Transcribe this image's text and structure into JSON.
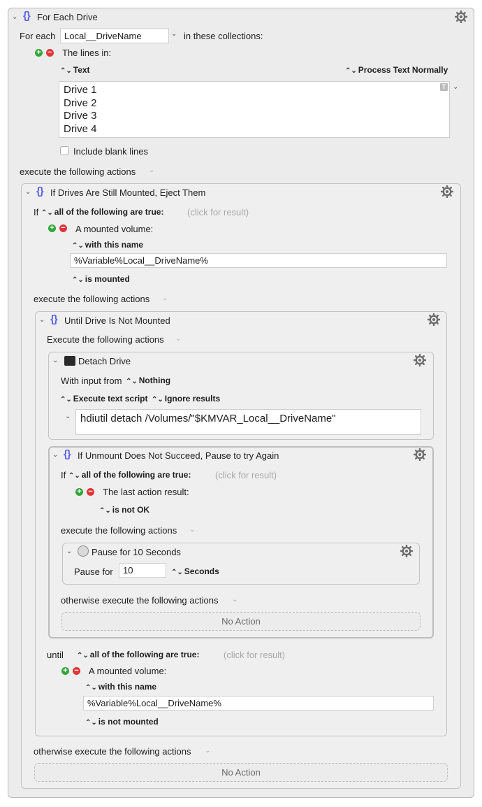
{
  "for_each": {
    "title": "For Each Drive",
    "for_each_label": "For each",
    "variable": "Local__DriveName",
    "in_collections": "in these collections:",
    "collection_title": "The lines in:",
    "text_label": "Text",
    "process_label": "Process Text Normally",
    "lines": [
      "Drive 1",
      "Drive 2",
      "Drive 3",
      "Drive 4"
    ],
    "include_blank": "Include blank lines",
    "execute_label": "execute the following actions"
  },
  "if_mounted": {
    "title": "If Drives Are Still Mounted, Eject Them",
    "if_label": "If",
    "condition_mode": "all of the following are true:",
    "click_result": "(click for result)",
    "condition_title": "A mounted volume:",
    "with_name": "with this name",
    "name_value": "%Variable%Local__DriveName%",
    "state": "is mounted",
    "execute_label": "execute the following actions",
    "otherwise_label": "otherwise execute the following actions",
    "no_action": "No Action"
  },
  "until_loop": {
    "title": "Until Drive Is Not Mounted",
    "execute_label": "Execute the following actions",
    "until_label": "until",
    "condition_mode": "all of the following are true:",
    "click_result": "(click for result)",
    "condition_title": "A mounted volume:",
    "with_name": "with this name",
    "name_value": "%Variable%Local__DriveName%",
    "state": "is not mounted"
  },
  "detach": {
    "title": "Detach Drive",
    "input_label": "With input from",
    "input_value": "Nothing",
    "mode": "Execute text script",
    "results": "Ignore results",
    "script": "hdiutil detach /Volumes/\"$KMVAR_Local__DriveName\""
  },
  "if_unmount": {
    "title": "If Unmount Does Not Succeed, Pause to try Again",
    "if_label": "If",
    "condition_mode": "all of the following are true:",
    "click_result": "(click for result)",
    "condition_title": "The last action result:",
    "state": "is not OK",
    "execute_label": "execute the following actions",
    "otherwise_label": "otherwise execute the following actions",
    "no_action": "No Action"
  },
  "pause": {
    "title": "Pause for 10 Seconds",
    "label": "Pause for",
    "value": "10",
    "unit": "Seconds"
  }
}
